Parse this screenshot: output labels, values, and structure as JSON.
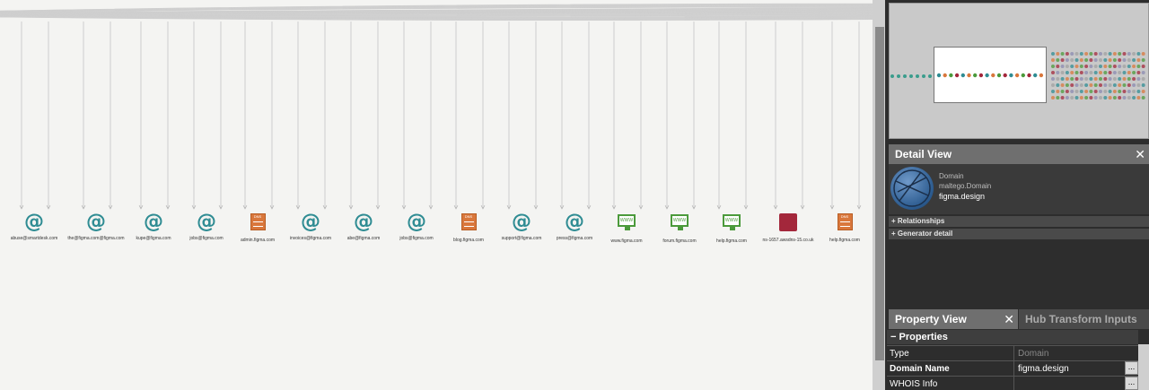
{
  "graph": {
    "nodes": [
      {
        "label": "abuse@smartdesk.com",
        "type": "email"
      },
      {
        "label": "the@figma.com@figma.com",
        "type": "email"
      },
      {
        "label": "kupe@figma.com",
        "type": "email"
      },
      {
        "label": "jobs@figma.com",
        "type": "email"
      },
      {
        "label": "admin.figma.com",
        "type": "dns"
      },
      {
        "label": "invoices@figma.com",
        "type": "email"
      },
      {
        "label": "abe@figma.com",
        "type": "email"
      },
      {
        "label": "jobs@figma.com",
        "type": "email"
      },
      {
        "label": "blog.figma.com",
        "type": "dns"
      },
      {
        "label": "support@figma.com",
        "type": "email"
      },
      {
        "label": "press@figma.com",
        "type": "email"
      },
      {
        "label": "www.figma.com",
        "type": "website"
      },
      {
        "label": "forum.figma.com",
        "type": "website"
      },
      {
        "label": "help.figma.com",
        "type": "website"
      },
      {
        "label": "ns-1657.awsdns-15.co.uk",
        "type": "nameserver"
      },
      {
        "label": "help.figma.com",
        "type": "dns"
      }
    ],
    "icon_labels": {
      "dns": "DNS",
      "website": "WWW"
    }
  },
  "detail_view": {
    "title": "Detail View",
    "entity_type": "Domain",
    "entity_class": "maltego.Domain",
    "entity_value": "figma.design",
    "sections": [
      "+ Relationships",
      "+ Generator detail"
    ]
  },
  "tabs": {
    "property_view": "Property View",
    "hub_transform_inputs": "Hub Transform Inputs"
  },
  "properties": {
    "header": "− Properties",
    "rows": [
      {
        "key": "Type",
        "value": "Domain",
        "bold": false,
        "button": false
      },
      {
        "key": "Domain Name",
        "value": "figma.design",
        "bold": true,
        "button": true
      },
      {
        "key": "WHOIS Info",
        "value": "",
        "bold": false,
        "button": true
      }
    ],
    "button_label": "..."
  },
  "colors": {
    "email": "#2f8c93",
    "dns": "#d9773c",
    "website": "#4b9a3b",
    "nameserver": "#a3273b",
    "panel_header": "#6f6f6f"
  }
}
